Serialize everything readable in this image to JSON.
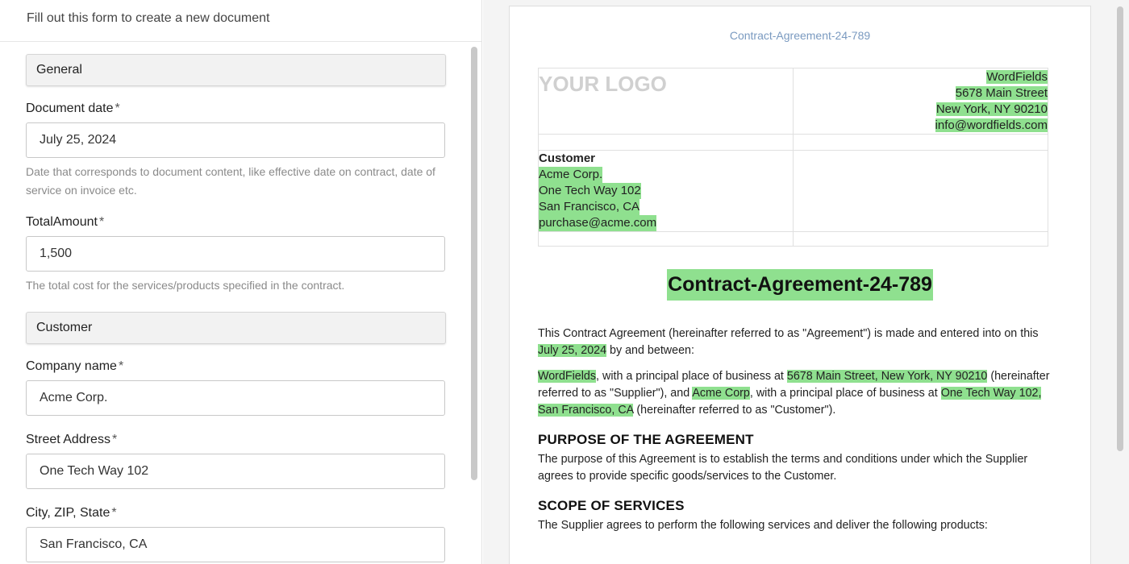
{
  "form": {
    "header": "Fill out this form to create a new document",
    "sections": {
      "general": "General",
      "customer": "Customer"
    },
    "fields": {
      "document_date": {
        "label": "Document date",
        "required_mark": "*",
        "value": "July 25, 2024",
        "hint": "Date that corresponds to document content, like effective date on contract, date of service on invoice etc."
      },
      "total_amount": {
        "label": "TotalAmount",
        "required_mark": "*",
        "value": "1,500",
        "hint": "The total cost for the services/products specified in the contract."
      },
      "company_name": {
        "label": "Company name",
        "required_mark": "*",
        "value": "Acme Corp."
      },
      "street_address": {
        "label": "Street Address",
        "required_mark": "*",
        "value": "One Tech Way 102"
      },
      "city_zip_state": {
        "label": "City, ZIP, State",
        "required_mark": "*",
        "value": "San Francisco, CA"
      }
    }
  },
  "document": {
    "header_title": "Contract-Agreement-24-789",
    "logo_text": "YOUR LOGO",
    "supplier": {
      "name": "WordFields",
      "street": "5678 Main Street",
      "city": "New York, NY 90210",
      "email": "info@wordfields.com"
    },
    "customer": {
      "heading": "Customer",
      "name": "Acme Corp.",
      "street": "One Tech Way 102",
      "city": "San Francisco, CA",
      "email": "purchase@acme.com"
    },
    "title": "Contract-Agreement-24-789",
    "intro": {
      "text1": "This Contract Agreement (hereinafter referred to as \"Agreement\") is made and entered into on this ",
      "date": "July 25, 2024",
      "text2": " by and between:"
    },
    "parties": {
      "supplier_name": "WordFields",
      "t1": ", with a principal place of business at ",
      "supplier_address": "5678 Main Street, New York, NY 90210",
      "t2": " (hereinafter referred to as \"Supplier\"), and ",
      "customer_name": "Acme Corp",
      "t3": ", with a principal place of business at ",
      "customer_address": "One Tech Way 102, San Francisco, CA",
      "t4": "  (hereinafter referred to as \"Customer\")."
    },
    "purpose": {
      "heading": "PURPOSE OF THE AGREEMENT",
      "text": "The purpose of this Agreement is to establish the terms and conditions under which the Supplier agrees to provide specific goods/services to the Customer."
    },
    "scope": {
      "heading": "SCOPE OF SERVICES",
      "text": "The Supplier agrees to perform the following services and deliver the following products:"
    }
  },
  "colors": {
    "highlight": "#8fe08f",
    "header_title": "#7a9ac0",
    "logo": "#d0d0d0"
  }
}
